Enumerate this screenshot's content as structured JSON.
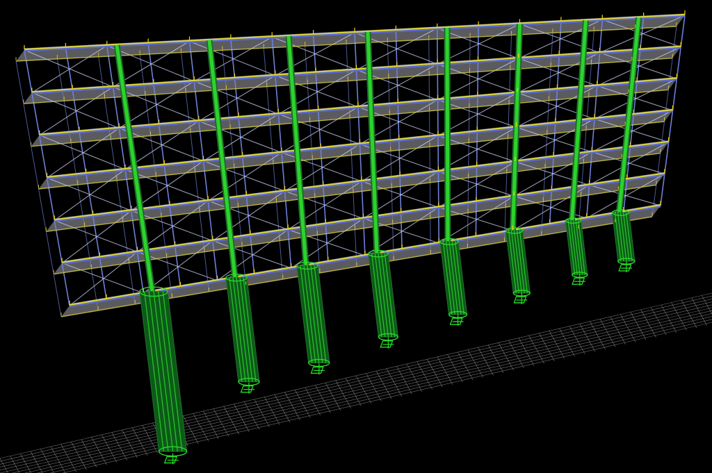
{
  "scene": {
    "background": "#000000",
    "colors": {
      "ground_grid": "#cfcfcf",
      "column": "#2bd42b",
      "column_edge": "#1f6b2a",
      "brace": "#6e80d8",
      "beam_top": "#d9d23a",
      "beam_edge": "#5a6ad0",
      "deck_fill": "#6b6b70",
      "cross_brace": "#c8d0f0",
      "support": "#22dd22",
      "node_marker": "#ffd400"
    },
    "structure": {
      "columns": 8,
      "deck_levels": 7,
      "pier_supports": 8
    },
    "icons": {
      "support": "fixed-support-icon",
      "node": "node-marker-icon"
    }
  }
}
